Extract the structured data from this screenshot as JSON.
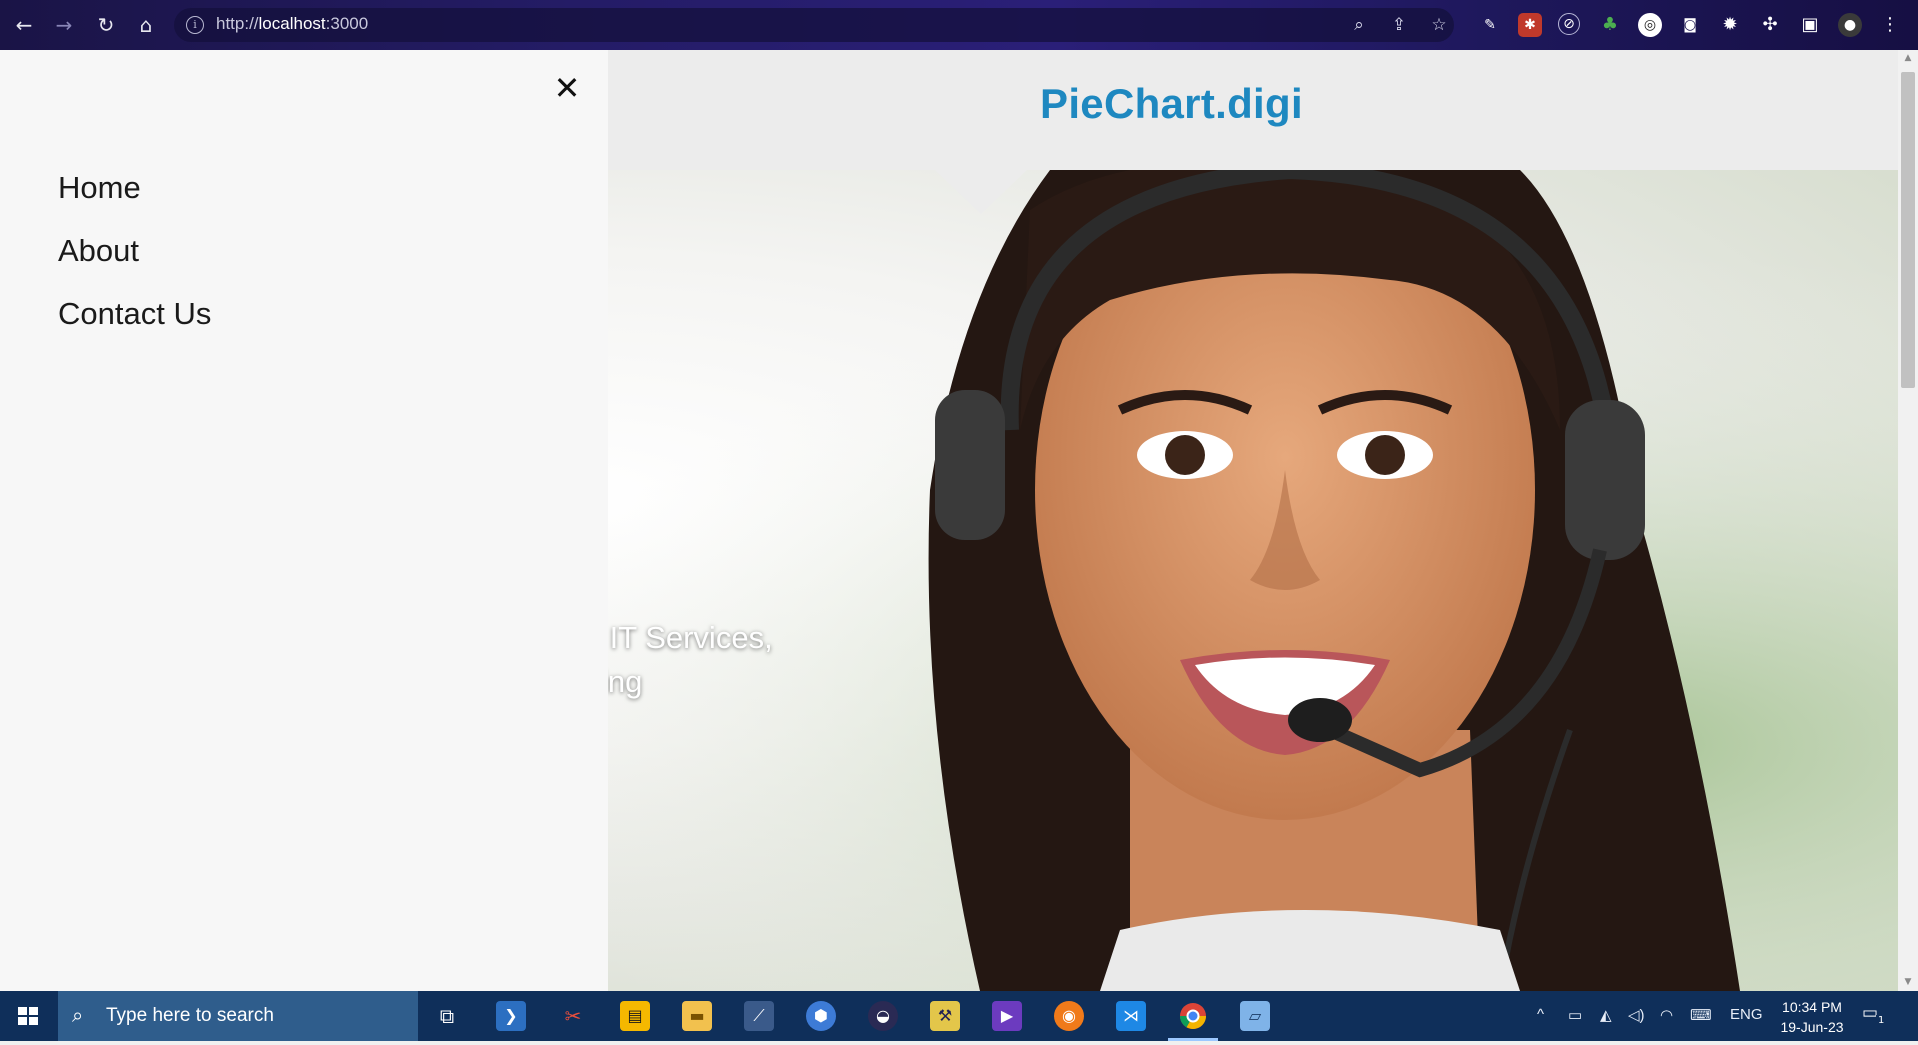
{
  "browser": {
    "url_scheme": "http://",
    "url_host": "localhost",
    "url_port": ":3000",
    "icons": [
      "back-icon",
      "forward-icon",
      "reload-icon",
      "home-icon",
      "zoom-icon",
      "share-icon",
      "bookmark-star-icon",
      "extensions-icon",
      "side-panel-icon",
      "profile-avatar",
      "menu-icon"
    ]
  },
  "page": {
    "brand": "PieChart.digi",
    "hero_line1": "vative IT Services,",
    "hero_line2": "Sourcing",
    "accent_color": "#1e88c0"
  },
  "drawer": {
    "close_symbol": "✕",
    "items": [
      {
        "label": "Home"
      },
      {
        "label": "About"
      },
      {
        "label": "Contact Us"
      }
    ]
  },
  "taskbar": {
    "search_placeholder": "Type here to search",
    "tray_language": "ENG",
    "clock_time": "10:34 PM",
    "clock_date": "19-Jun-23",
    "notification_count": "1"
  }
}
